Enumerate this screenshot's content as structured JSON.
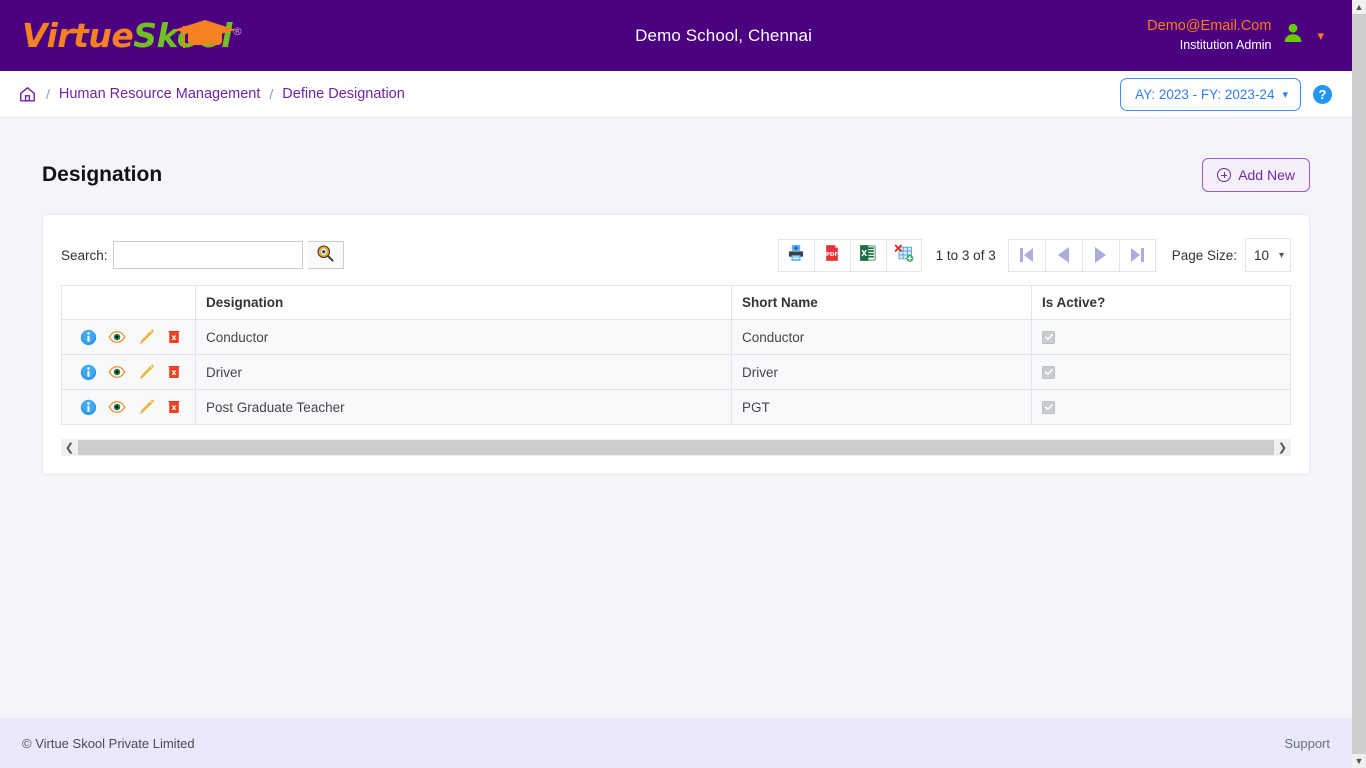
{
  "header": {
    "logo": {
      "part1": "Virtue",
      "part2": "Skool",
      "registered": "®",
      "cap_icon": "graduation-cap-icon"
    },
    "school_title": "Demo School, Chennai",
    "user_email": "Demo@Email.Com",
    "user_role": "Institution Admin",
    "avatar_icon": "user-avatar-icon",
    "user_chevron": "chevron-down-icon"
  },
  "breadcrumb": {
    "home_icon": "home-icon",
    "separator": "/",
    "items": [
      {
        "label": "Human Resource Management"
      },
      {
        "label": "Define Designation"
      }
    ],
    "academic_year": "AY: 2023 - FY: 2023-24",
    "ay_chevron": "chevron-down-icon",
    "help_label": "?"
  },
  "page": {
    "title": "Designation",
    "add_new_label": "Add New",
    "add_new_icon": "plus-circle-icon"
  },
  "toolbar": {
    "search_label": "Search:",
    "search_value": "",
    "search_placeholder": "",
    "search_icon": "magnifier-icon",
    "exports": [
      {
        "name": "print-button",
        "icon": "printer-icon"
      },
      {
        "name": "pdf-export-button",
        "icon": "pdf-icon",
        "label": "PDF"
      },
      {
        "name": "excel-export-button",
        "icon": "excel-icon",
        "label": "X"
      },
      {
        "name": "xml-export-button",
        "icon": "xml-export-icon"
      }
    ],
    "page_info": "1 to 3 of 3",
    "pager": [
      {
        "name": "first-page-button",
        "icon": "first-page-icon"
      },
      {
        "name": "previous-page-button",
        "icon": "previous-page-icon"
      },
      {
        "name": "next-page-button",
        "icon": "next-page-icon"
      },
      {
        "name": "last-page-button",
        "icon": "last-page-icon"
      }
    ],
    "page_size_label": "Page Size:",
    "page_size_value": "10",
    "page_size_chevron": "chevron-down-icon"
  },
  "table": {
    "columns": [
      "",
      "Designation",
      "Short Name",
      "Is Active?"
    ],
    "row_actions": [
      {
        "name": "info-action",
        "icon": "info-circle-icon"
      },
      {
        "name": "view-action",
        "icon": "eye-icon"
      },
      {
        "name": "edit-action",
        "icon": "pencil-icon"
      },
      {
        "name": "delete-action",
        "icon": "delete-red-icon"
      }
    ],
    "rows": [
      {
        "designation": "Conductor",
        "short_name": "Conductor",
        "is_active": true
      },
      {
        "designation": "Driver",
        "short_name": "Driver",
        "is_active": true
      },
      {
        "designation": "Post Graduate Teacher",
        "short_name": "PGT",
        "is_active": true
      }
    ],
    "hscroll": {
      "left_icon": "chevron-left-icon",
      "right_icon": "chevron-right-icon"
    }
  },
  "footer": {
    "copyright": "© Virtue Skool Private Limited",
    "support": "Support"
  },
  "colors": {
    "header_purple": "#4b0082",
    "logo_orange": "#f58220",
    "logo_green": "#72bf20",
    "link_purple": "#7322a8",
    "accent_blue": "#2f7df0",
    "page_bg": "#f4f5fa",
    "footer_bg": "#eae8fb"
  },
  "scrollbar": {
    "up_icon": "chevron-up-icon",
    "down_icon": "chevron-down-icon"
  }
}
